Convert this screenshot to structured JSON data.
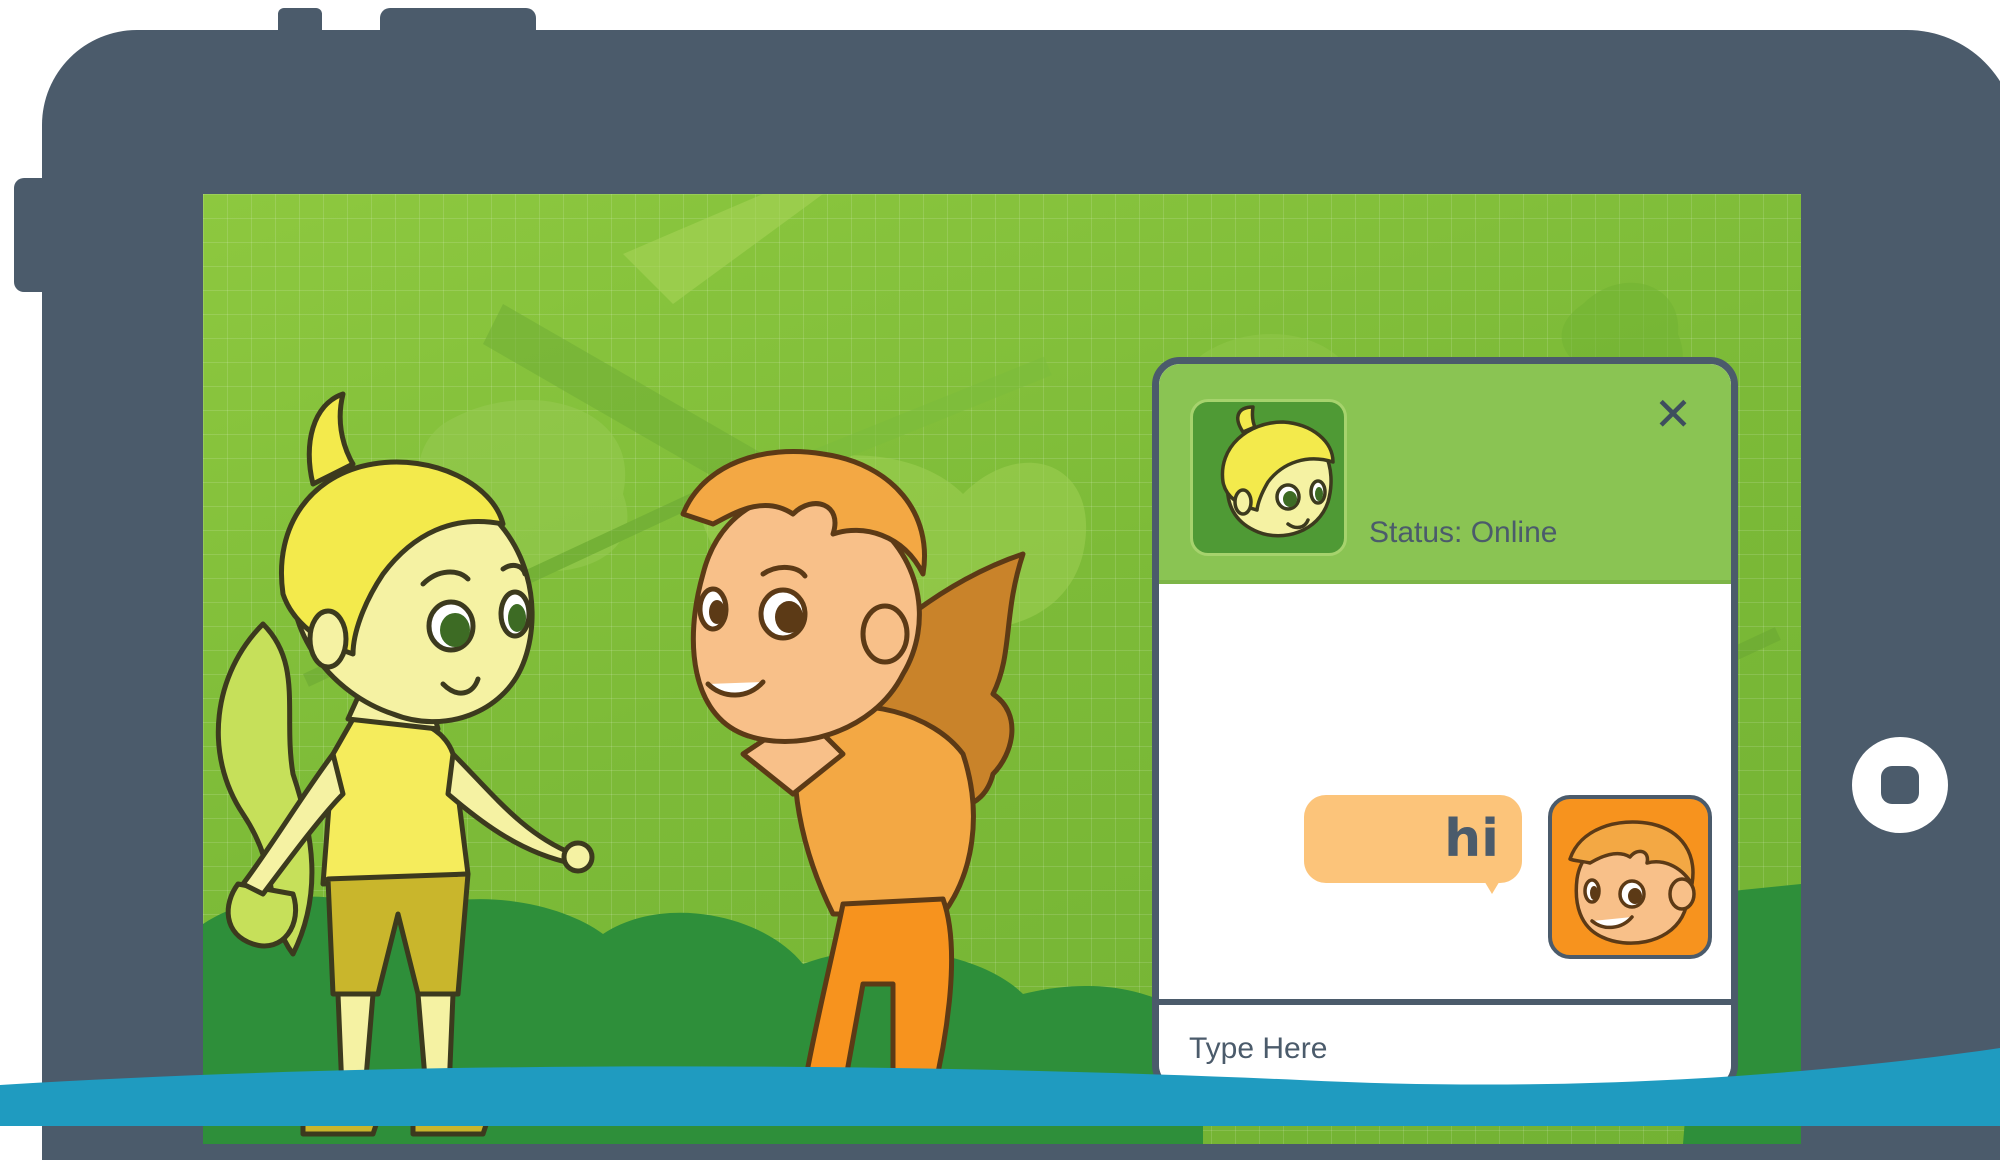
{
  "chat": {
    "status_text": "Status: Online",
    "close_glyph": "✕",
    "messages": [
      {
        "text": "hi",
        "sender": "boy"
      }
    ],
    "input_placeholder": "Type Here"
  },
  "icons": {
    "close": "close-icon",
    "home": "home-button-icon"
  },
  "colors": {
    "tablet_frame": "#4b5b6b",
    "screen_green": "#86c23e",
    "chat_header": "#8ac453",
    "message_bubble": "#fcc47a",
    "sender_avatar_bg": "#f7931e",
    "wave_blue": "#1f9bc0"
  }
}
